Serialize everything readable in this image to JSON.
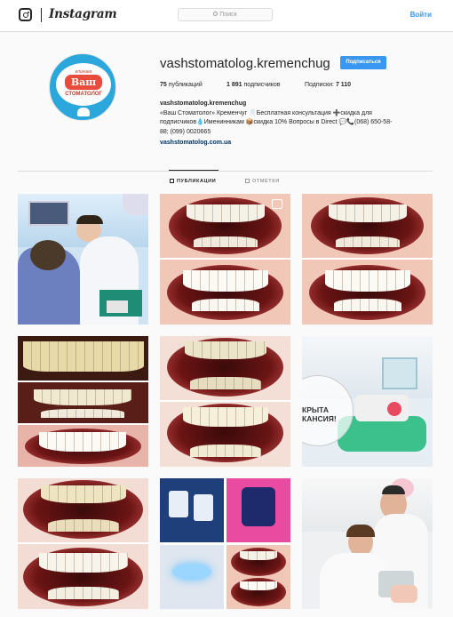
{
  "nav": {
    "wordmark": "Instagram",
    "search_placeholder": "Поиск",
    "login_label": "Войти"
  },
  "profile": {
    "username": "vashstomatolog.kremenchug",
    "follow_label": "Подписаться",
    "avatar": {
      "top_text": "клиника",
      "main_text": "Ваш",
      "bottom_text": "СТОМАТОЛОГ"
    },
    "stats": {
      "posts": "75",
      "posts_label": "публикаций",
      "followers": "1 891",
      "followers_label": "подписчиков",
      "following_label": "Подписки:",
      "following": "7 110"
    },
    "bio": {
      "name": "vashstomatolog.kremenchug",
      "line1": "«Ваш Стоматолог» Кременчуг 🦷Бесплатная консультация ➕скидка для",
      "line2": "подписчиков💧Именинникам 📦скидка 10% Вопросы в Direct 💬📞(068) 650-58-",
      "line3": "88; (099) 0020665",
      "link": "vashstomatolog.com.ua"
    }
  },
  "tabs": {
    "posts": "Публикации",
    "tagged": "Отметки"
  },
  "grid": {
    "overlay_text_line1": "КРЫТА",
    "overlay_text_line2": "КАНСИЯ!"
  },
  "colors": {
    "accent": "#3897f0",
    "text": "#262626",
    "muted": "#999999",
    "background": "#fafafa"
  }
}
